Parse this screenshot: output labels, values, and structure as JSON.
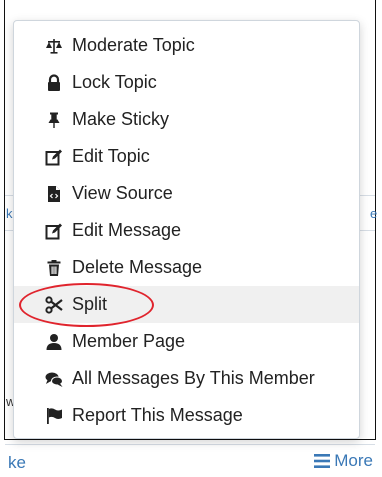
{
  "menu": {
    "items": [
      {
        "label": "Moderate Topic",
        "icon": "scales-icon"
      },
      {
        "label": "Lock Topic",
        "icon": "lock-icon"
      },
      {
        "label": "Make Sticky",
        "icon": "pin-icon"
      },
      {
        "label": "Edit Topic",
        "icon": "edit-icon"
      },
      {
        "label": "View Source",
        "icon": "file-code-icon"
      },
      {
        "label": "Edit Message",
        "icon": "edit-icon"
      },
      {
        "label": "Delete Message",
        "icon": "trash-icon"
      },
      {
        "label": "Split",
        "icon": "scissors-icon"
      },
      {
        "label": "Member Page",
        "icon": "user-icon"
      },
      {
        "label": "All Messages By This Member",
        "icon": "comments-icon"
      },
      {
        "label": "Report This Message",
        "icon": "flag-icon"
      }
    ],
    "highlighted_item": "Split"
  },
  "background": {
    "left_fragment_1": "ke",
    "left_fragment_2": "w",
    "right_fragment": "e",
    "bottom_like": "ke",
    "more_label": "More"
  },
  "colors": {
    "link": "#3a78b6",
    "highlight_ring": "#e0242d",
    "menu_hover": "#f0f0f0"
  }
}
